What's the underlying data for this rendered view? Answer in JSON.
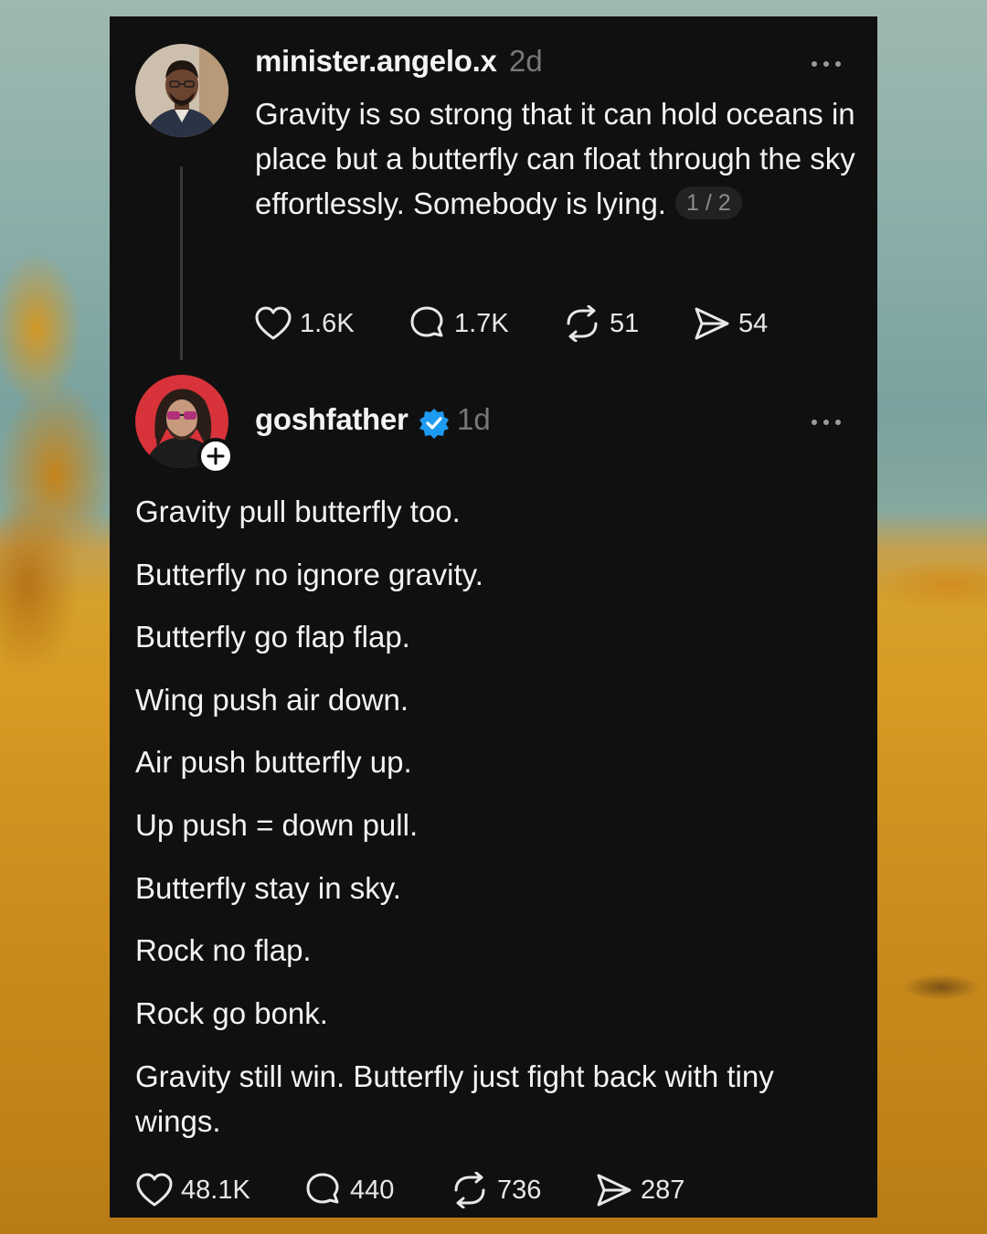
{
  "original_post": {
    "username": "minister.angelo.x",
    "time": "2d",
    "text": "Gravity is so strong that it can hold oceans in place but a butterfly can float through the sky effortlessly. Somebody is lying.",
    "page_indicator": "1 / 2",
    "actions": {
      "likes": "1.6K",
      "replies": "1.7K",
      "reposts": "51",
      "shares": "54"
    }
  },
  "reply_post": {
    "username": "goshfather",
    "verified": true,
    "time": "1d",
    "lines": [
      "Gravity pull butterfly too.",
      "Butterfly no ignore gravity.",
      "Butterfly go flap flap.",
      "Wing push air down.",
      "Air push butterfly up.",
      "Up push = down pull.",
      "Butterfly stay in sky.",
      "Rock no flap.",
      "Rock go bonk.",
      "Gravity still win. Butterfly just fight back with tiny wings."
    ],
    "actions": {
      "likes": "48.1K",
      "replies": "440",
      "reposts": "736",
      "shares": "287"
    }
  },
  "colors": {
    "panel": "#101010",
    "text": "#f3f3f3",
    "muted": "#777777",
    "verified": "#1d9bf0"
  }
}
